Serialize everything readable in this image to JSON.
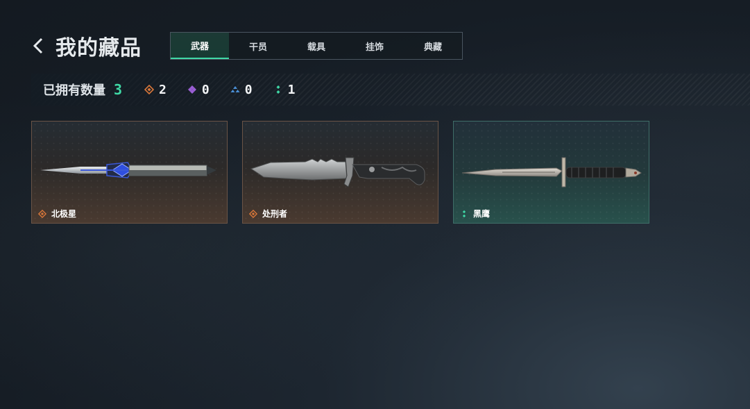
{
  "header": {
    "title": "我的藏品",
    "back_icon": "chevron-left-icon"
  },
  "tabs": [
    {
      "label": "武器",
      "active": true
    },
    {
      "label": "干员",
      "active": false
    },
    {
      "label": "载具",
      "active": false
    },
    {
      "label": "挂饰",
      "active": false
    },
    {
      "label": "典藏",
      "active": false
    }
  ],
  "stats": {
    "owned_label": "已拥有数量",
    "owned_count": "3",
    "rarities": [
      {
        "icon": "orange-diamond-icon",
        "color": "#d9773a",
        "count": "2"
      },
      {
        "icon": "purple-diamond-icon",
        "color": "#9b5fd6",
        "count": "0"
      },
      {
        "icon": "blue-triangle-icon",
        "color": "#4a8fd6",
        "count": "0"
      },
      {
        "icon": "green-dots-icon",
        "color": "#3fd9a6",
        "count": "1"
      }
    ]
  },
  "items": [
    {
      "name": "北极星",
      "rarity_icon": "orange-diamond-icon",
      "rarity_color": "#d9773a",
      "weapon_icon": "dagger-icon"
    },
    {
      "name": "处刑者",
      "rarity_icon": "orange-diamond-icon",
      "rarity_color": "#d9773a",
      "weapon_icon": "combat-knife-icon"
    },
    {
      "name": "黑鹰",
      "rarity_icon": "green-dots-icon",
      "rarity_color": "#3fd9a6",
      "weapon_icon": "bayonet-knife-icon"
    }
  ],
  "colors": {
    "accent": "#3fd9a6",
    "orange": "#d9773a",
    "purple": "#9b5fd6",
    "blue": "#4a8fd6"
  }
}
